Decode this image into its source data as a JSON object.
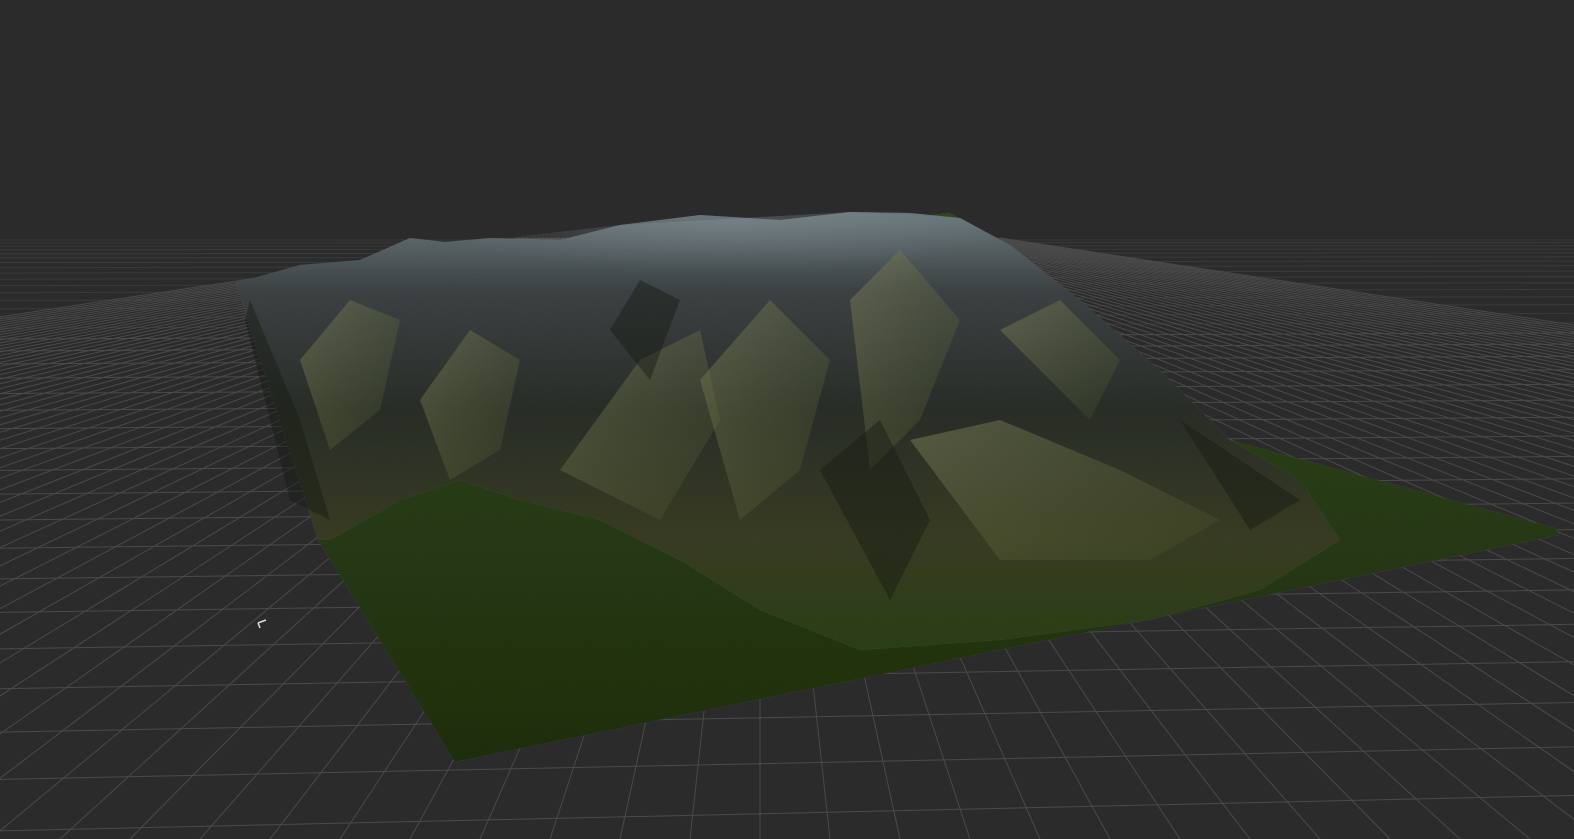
{
  "viewport": {
    "background_color": "#2b2b2b",
    "grid_line_color": "#4a4a4a",
    "grid_line_color_far": "#3a3a3a",
    "terrain": {
      "peak_color": "#6f7c80",
      "ridge_color": "#3a3f38",
      "shadow_color": "#1e231c",
      "foothill_color": "#5d6030",
      "meadow_color": "#2c4116",
      "meadow_color_dark": "#223212"
    }
  }
}
